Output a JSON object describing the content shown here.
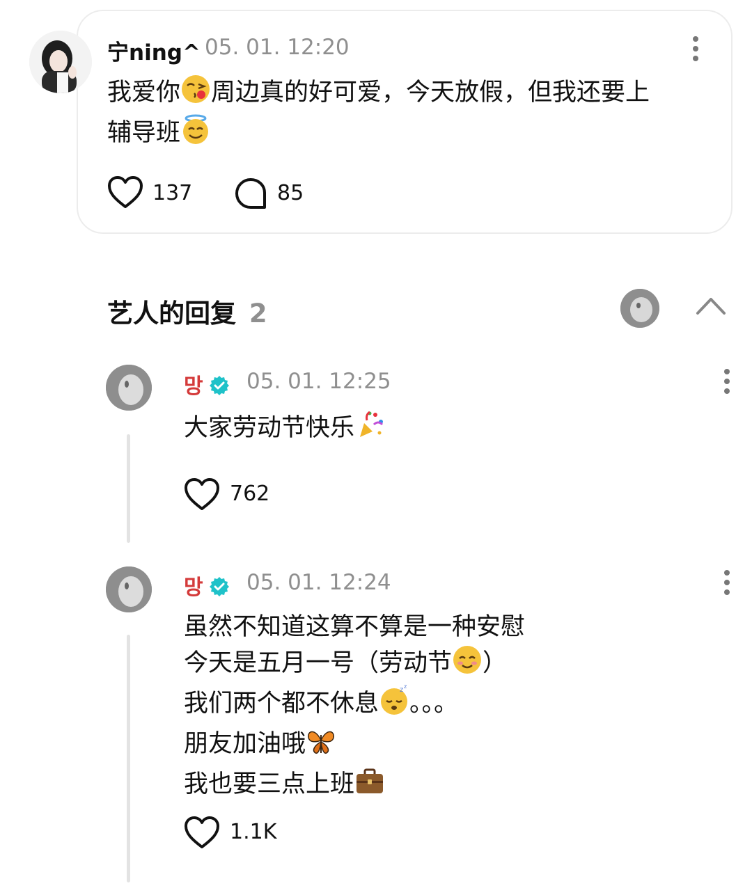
{
  "fan_post": {
    "username": "宁ning^",
    "timestamp": "05. 01. 12:20",
    "text_line1": "我爱你",
    "text_line1b": "周边真的好可爱，今天放假，但我还要上",
    "text_line2": "辅导班",
    "likes": "137",
    "comments": "85"
  },
  "replies_header": {
    "title": "艺人的回复",
    "count": "2"
  },
  "replies": [
    {
      "username": "망",
      "verified": true,
      "timestamp": "05. 01. 12:25",
      "lines": [
        "大家劳动节快乐"
      ],
      "likes": "762"
    },
    {
      "username": "망",
      "verified": true,
      "timestamp": "05. 01. 12:24",
      "lines": [
        "虽然不知道这算不算是一种安慰",
        "今天是五月一号（劳动节",
        "）",
        "我们两个都不休息",
        "。。。",
        "朋友加油哦",
        "我也要三点上班"
      ],
      "likes": "1.1K"
    }
  ],
  "colors": {
    "verified": "#1fc2c9",
    "artist_name": "#d43a3a",
    "muted": "#8f8f8f"
  }
}
